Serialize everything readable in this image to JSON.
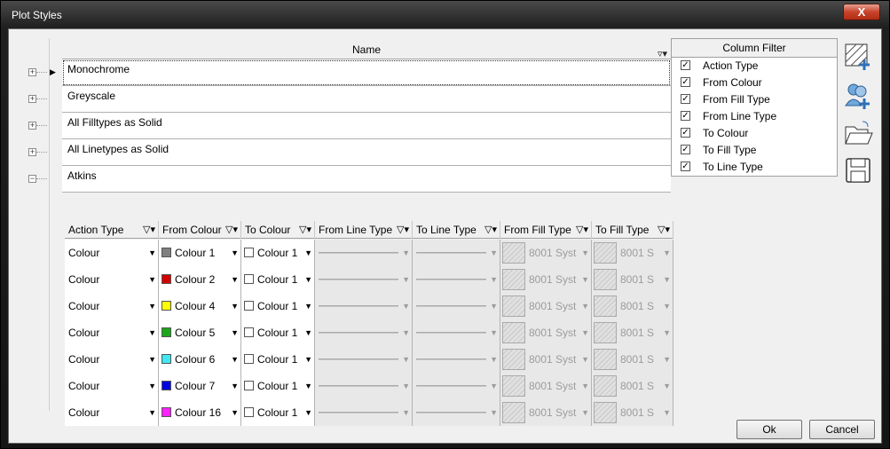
{
  "window": {
    "title": "Plot Styles",
    "close_glyph": "X"
  },
  "grid": {
    "name_header": "Name",
    "rows": [
      {
        "name": "Monochrome",
        "expander": "+"
      },
      {
        "name": "Greyscale",
        "expander": "+"
      },
      {
        "name": "All Filltypes as Solid",
        "expander": "+"
      },
      {
        "name": "All Linetypes as Solid",
        "expander": "+"
      },
      {
        "name": "Atkins",
        "expander": "−"
      }
    ],
    "sub_columns": [
      "Action Type",
      "From Colour",
      "To Colour",
      "From Line Type",
      "To Line Type",
      "From Fill Type",
      "To Fill Type"
    ],
    "sub_rows": [
      {
        "action": "Colour",
        "from_colour": "Colour 1",
        "from_hex": "#808080",
        "to_colour": "Colour 1",
        "from_fill": "8001 Syst",
        "to_fill": "8001 S"
      },
      {
        "action": "Colour",
        "from_colour": "Colour 2",
        "from_hex": "#d40000",
        "to_colour": "Colour 1",
        "from_fill": "8001 Syst",
        "to_fill": "8001 S"
      },
      {
        "action": "Colour",
        "from_colour": "Colour 4",
        "from_hex": "#ffff00",
        "to_colour": "Colour 1",
        "from_fill": "8001 Syst",
        "to_fill": "8001 S"
      },
      {
        "action": "Colour",
        "from_colour": "Colour 5",
        "from_hex": "#1aa81a",
        "to_colour": "Colour 1",
        "from_fill": "8001 Syst",
        "to_fill": "8001 S"
      },
      {
        "action": "Colour",
        "from_colour": "Colour 6",
        "from_hex": "#40e8f0",
        "to_colour": "Colour 1",
        "from_fill": "8001 Syst",
        "to_fill": "8001 S"
      },
      {
        "action": "Colour",
        "from_colour": "Colour 7",
        "from_hex": "#0000e0",
        "to_colour": "Colour 1",
        "from_fill": "8001 Syst",
        "to_fill": "8001 S"
      },
      {
        "action": "Colour",
        "from_colour": "Colour 16",
        "from_hex": "#ff20ff",
        "to_colour": "Colour 1",
        "from_fill": "8001 Syst",
        "to_fill": "8001 S"
      }
    ]
  },
  "column_filter": {
    "title": "Column Filter",
    "items": [
      "Action Type",
      "From Colour",
      "From Fill Type",
      "From Line Type",
      "To Colour",
      "To Fill Type",
      "To Line Type"
    ]
  },
  "buttons": {
    "ok": "Ok",
    "cancel": "Cancel"
  }
}
